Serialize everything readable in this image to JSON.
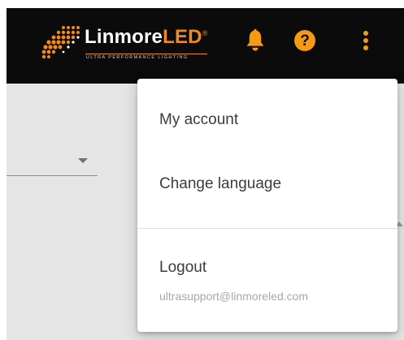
{
  "header": {
    "brand": {
      "name_part1": "Linmore",
      "name_part2": "LED",
      "registered": "®",
      "tagline": "ULTRA PERFORMANCE LIGHTING"
    },
    "icons": {
      "notifications": "bell-icon",
      "help": "help-icon",
      "more": "more-vertical-icon"
    },
    "help_label": "?",
    "background": "#0b0b0b",
    "accent": "#f59a14"
  },
  "user_menu": {
    "items": [
      {
        "label": "My account"
      },
      {
        "label": "Change language"
      },
      {
        "label": "Logout"
      }
    ],
    "email": "ultrasupport@linmoreled.com"
  },
  "colors": {
    "brand_orange": "#f08a1c",
    "page_background": "#e5e5e5",
    "menu_background": "#ffffff",
    "menu_text": "#3c3c3c",
    "email_text": "#a8a8a8"
  }
}
